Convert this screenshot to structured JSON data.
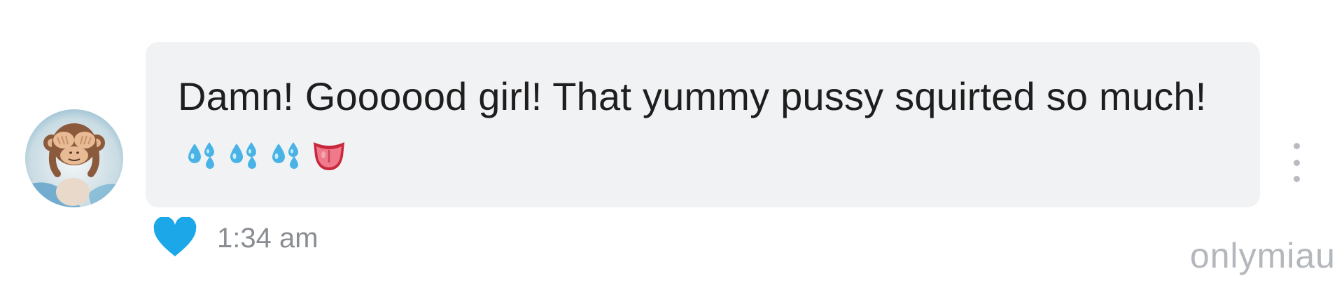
{
  "message": {
    "text": "Damn! Goooood girl! That yummy pussy squirted so much!",
    "emojis": [
      "sweat-droplets-emoji",
      "sweat-droplets-emoji",
      "sweat-droplets-emoji",
      "tongue-emoji"
    ],
    "timestamp": "1:34 am",
    "liked": true
  },
  "avatar": {
    "icon": "see-no-evil-monkey"
  },
  "watermark": "onlymiau",
  "colors": {
    "bubble": "#f1f2f4",
    "heart": "#1ca8e8",
    "droplets": "#4ab3e6",
    "timestamp": "#8a8d92",
    "watermark": "#b4b7bb"
  }
}
